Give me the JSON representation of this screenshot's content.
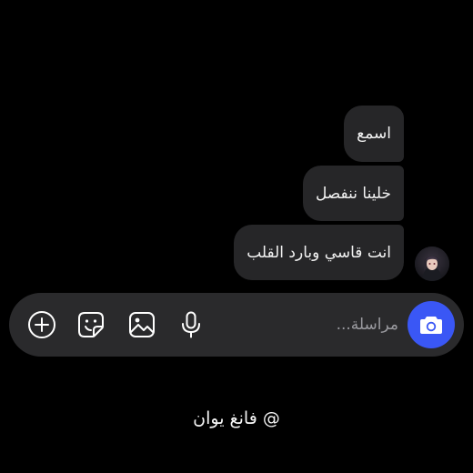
{
  "conversation": {
    "messages": [
      {
        "text": "اسمع"
      },
      {
        "text": "خلينا ننفصل"
      },
      {
        "text": "انت قاسي وبارد القلب"
      }
    ]
  },
  "composer": {
    "placeholder": "مراسلة...",
    "tools": [
      {
        "icon": "camera-icon"
      },
      {
        "icon": "microphone-icon"
      },
      {
        "icon": "image-icon"
      },
      {
        "icon": "sticker-icon"
      },
      {
        "icon": "plus-icon"
      }
    ]
  },
  "footer": {
    "handle": "@ فانغ يوان"
  },
  "colors": {
    "background": "#000000",
    "bubble": "#262628",
    "composer": "#2a2a2c",
    "accent": "#3a57f5",
    "placeholder": "#9a9a9f"
  }
}
